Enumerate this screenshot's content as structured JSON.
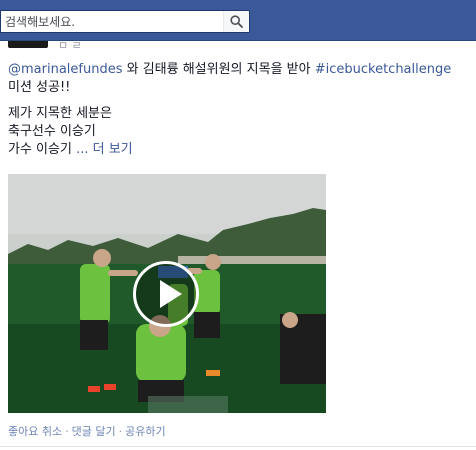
{
  "topbar": {
    "brand_color": "#3b5998",
    "search": {
      "placeholder": "검색해보세요."
    },
    "search_icon": "magnifier-icon"
  },
  "post": {
    "meta_fragment": "ㅁ ㄹ",
    "text": {
      "mention": "@marinalefundes",
      "line1_rest": " 와 김태륭 해설위원의 지목을 받아 ",
      "hashtag": "#icebucketchallenge",
      "line2": "미션 성공!!",
      "line3": "제가 지목한 세분은",
      "line4": "축구선수 이승기",
      "line5_prefix": "가수 이승기 ",
      "see_more": "... 더 보기"
    },
    "video": {
      "play_icon": "play-icon",
      "description_colors": {
        "sky": "#d4d7d5",
        "grass": "#1f5a26",
        "jersey": "#6cc13e"
      }
    },
    "actions": {
      "unlike": "좋아요 취소",
      "comment": "댓글 달기",
      "share": "공유하기",
      "separator": "·"
    }
  }
}
